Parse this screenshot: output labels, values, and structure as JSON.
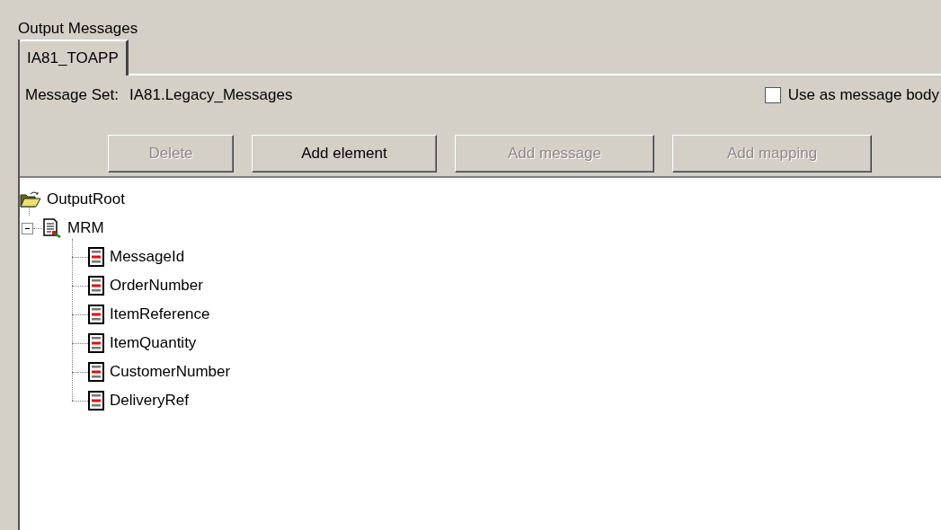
{
  "section_title": "Output Messages",
  "tabs": [
    {
      "label": "IA81_TOAPP",
      "selected": true
    }
  ],
  "message_set": {
    "label": "Message Set:",
    "value": "IA81.Legacy_Messages"
  },
  "use_as_body": {
    "label": "Use as message body",
    "checked": false
  },
  "buttons": [
    {
      "label": "Delete",
      "disabled": true
    },
    {
      "label": "Add element",
      "disabled": false
    },
    {
      "label": "Add message",
      "disabled": true
    },
    {
      "label": "Add mapping",
      "disabled": true
    }
  ],
  "tree": {
    "label": "OutputRoot",
    "expanded": true,
    "children": [
      {
        "label": "MRM",
        "expanded": true,
        "children": [
          {
            "label": "MessageId"
          },
          {
            "label": "OrderNumber"
          },
          {
            "label": "ItemReference"
          },
          {
            "label": "ItemQuantity"
          },
          {
            "label": "CustomerNumber"
          },
          {
            "label": "DeliveryRef"
          }
        ]
      }
    ]
  }
}
